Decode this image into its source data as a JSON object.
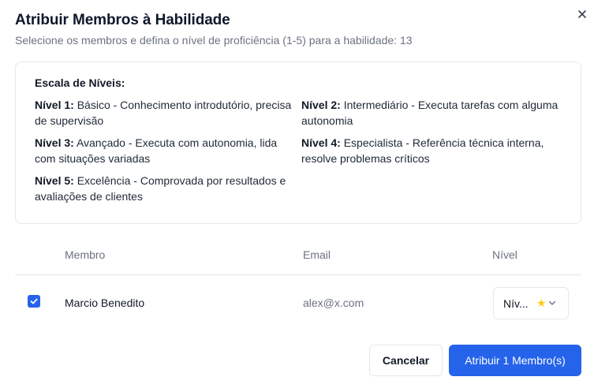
{
  "dialog": {
    "title": "Atribuir Membros à Habilidade",
    "subtitle": "Selecione os membros e defina o nível de proficiência (1-5) para a habilidade: 13",
    "close_icon": "close-icon"
  },
  "scale": {
    "title": "Escala de Níveis:",
    "levels": [
      {
        "label": "Nível 1:",
        "text": "Básico - Conhecimento introdutório, precisa de supervisão"
      },
      {
        "label": "Nível 2:",
        "text": "Intermediário - Executa tarefas com alguma autonomia"
      },
      {
        "label": "Nível 3:",
        "text": "Avançado - Executa com autonomia, lida com situações variadas"
      },
      {
        "label": "Nível 4:",
        "text": "Especialista - Referência técnica interna, resolve problemas críticos"
      },
      {
        "label": "Nível 5:",
        "text": "Excelência - Comprovada por resultados e avaliações de clientes"
      }
    ]
  },
  "table": {
    "headers": {
      "member": "Membro",
      "email": "Email",
      "level": "Nível"
    },
    "rows": [
      {
        "checked": true,
        "name": "Marcio Benedito",
        "email": "alex@x.com",
        "level_display": "Nív...",
        "level_icon": "star-icon"
      }
    ]
  },
  "footer": {
    "cancel_label": "Cancelar",
    "assign_label": "Atribuir 1 Membro(s)"
  },
  "colors": {
    "accent": "#2563eb",
    "star": "#facc15",
    "muted_text": "#6b7280",
    "border": "#e5e7eb"
  }
}
